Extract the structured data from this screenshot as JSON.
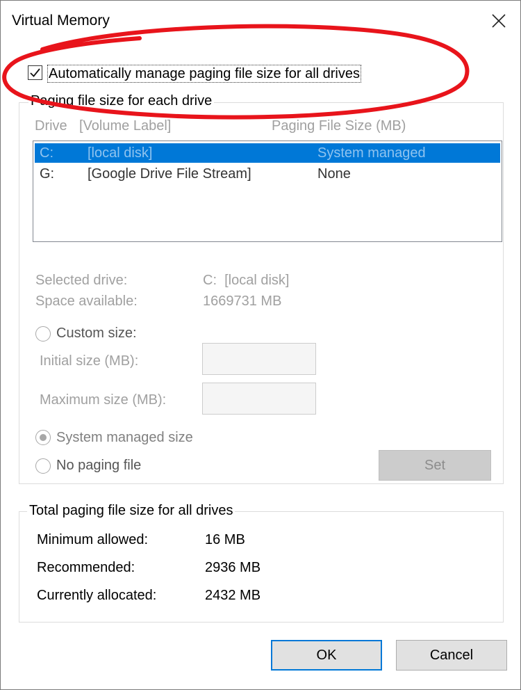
{
  "window": {
    "title": "Virtual Memory"
  },
  "auto_manage": {
    "label": "Automatically manage paging file size for all drives",
    "checked": true
  },
  "paging_group": {
    "legend": "Paging file size for each drive",
    "col_drive": "Drive",
    "col_label": "[Volume Label]",
    "col_size": "Paging File Size (MB)",
    "drives": [
      {
        "letter": "C:",
        "label": "[local disk]",
        "size": "System managed",
        "selected": true
      },
      {
        "letter": "G:",
        "label": "[Google Drive File Stream]",
        "size": "None",
        "selected": false
      }
    ],
    "selected_drive_label": "Selected drive:",
    "selected_drive_value": "C:  [local disk]",
    "space_label": "Space available:",
    "space_value": "1669731 MB",
    "custom_size_label": "Custom size:",
    "initial_label": "Initial size (MB):",
    "maximum_label": "Maximum size (MB):",
    "initial_value": "",
    "maximum_value": "",
    "system_managed_label": "System managed size",
    "no_paging_label": "No paging file",
    "set_label": "Set"
  },
  "total_group": {
    "legend": "Total paging file size for all drives",
    "min_label": "Minimum allowed:",
    "min_value": "16 MB",
    "recommended_label": "Recommended:",
    "recommended_value": "2936 MB",
    "allocated_label": "Currently allocated:",
    "allocated_value": "2432 MB"
  },
  "buttons": {
    "ok": "OK",
    "cancel": "Cancel"
  },
  "colors": {
    "selection": "#0078d7",
    "annotation": "#e8141b",
    "disabled_text": "#a0a0a0"
  }
}
